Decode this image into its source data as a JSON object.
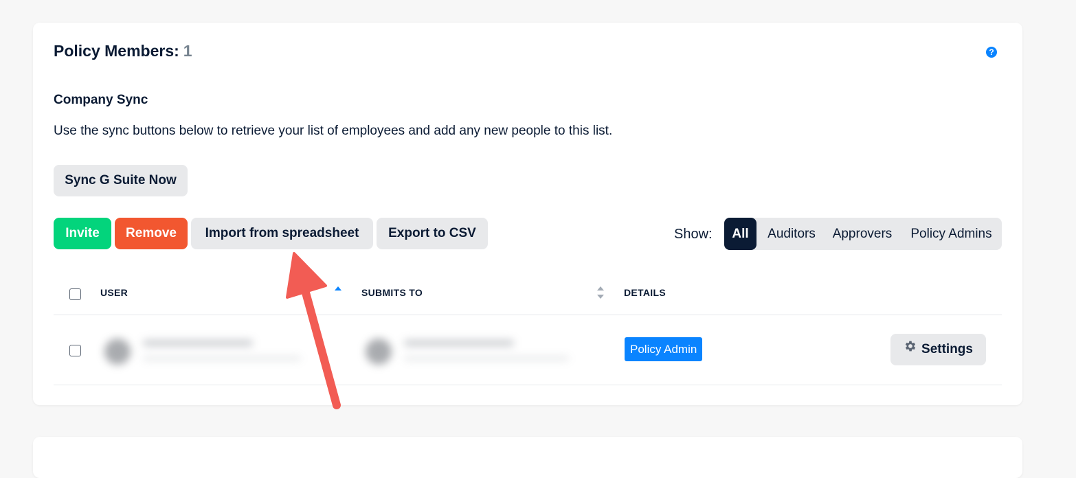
{
  "header": {
    "title": "Policy Members:",
    "count": "1",
    "help_icon": "?"
  },
  "sync": {
    "title": "Company Sync",
    "description": "Use the sync buttons below to retrieve your list of employees and add any new people to this list.",
    "sync_button": "Sync G Suite Now"
  },
  "toolbar": {
    "invite": "Invite",
    "remove": "Remove",
    "import": "Import from spreadsheet",
    "export": "Export to CSV"
  },
  "filter": {
    "label": "Show:",
    "options": [
      "All",
      "Auditors",
      "Approvers",
      "Policy Admins"
    ],
    "selected": "All"
  },
  "table": {
    "columns": [
      "USER",
      "SUBMITS TO",
      "DETAILS"
    ],
    "rows": [
      {
        "details_badge": "Policy Admin",
        "settings_label": "Settings"
      }
    ]
  },
  "colors": {
    "primary_text": "#0b1b34",
    "accent_blue": "#0a84ff",
    "success_green": "#03d47c",
    "danger_red": "#f25730",
    "annotation_arrow": "#f25c54"
  }
}
